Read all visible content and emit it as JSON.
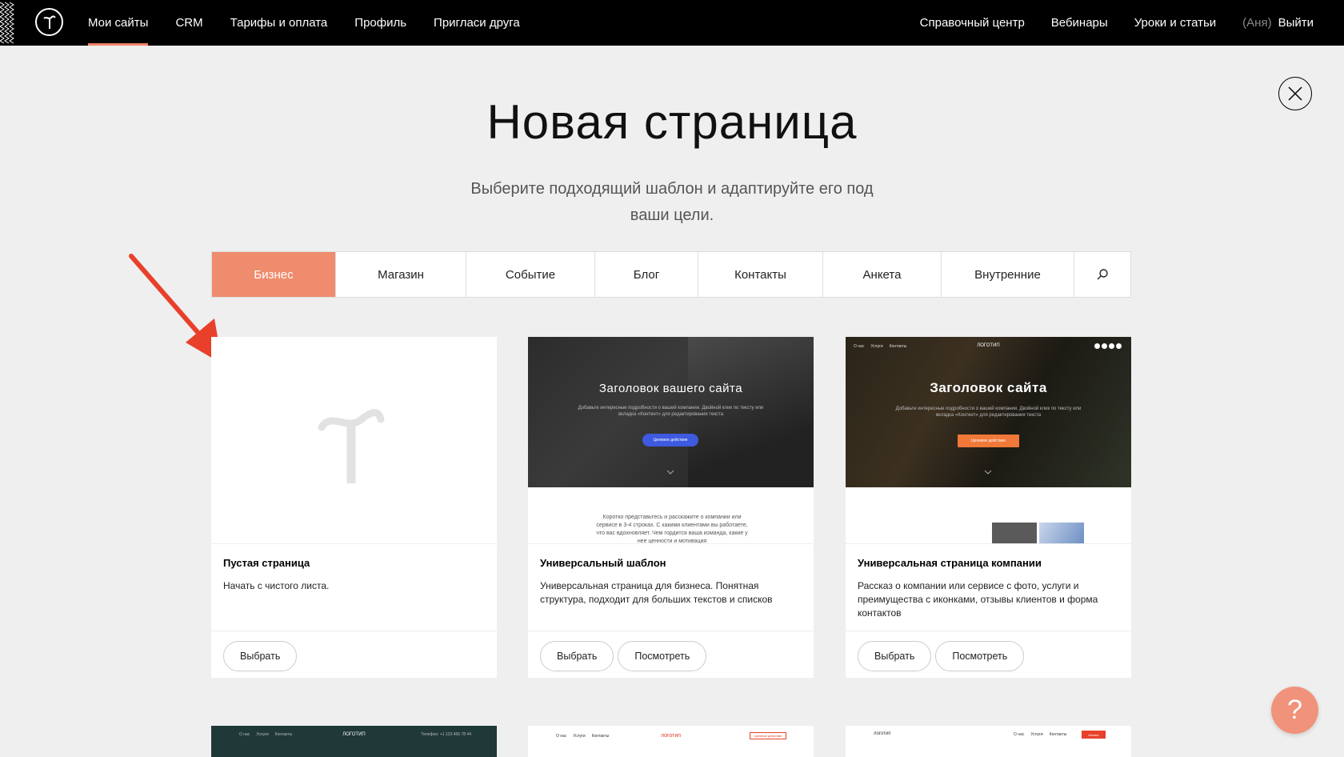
{
  "nav": {
    "left": [
      {
        "label": "Мои сайты",
        "active": true
      },
      {
        "label": "CRM"
      },
      {
        "label": "Тарифы и оплата"
      },
      {
        "label": "Профиль"
      },
      {
        "label": "Пригласи друга"
      }
    ],
    "right": [
      {
        "label": "Справочный центр"
      },
      {
        "label": "Вебинары"
      },
      {
        "label": "Уроки и статьи"
      }
    ],
    "user": "(Аня)",
    "logout": "Выйти"
  },
  "header": {
    "title": "Новая страница",
    "subtitle": "Выберите подходящий шаблон и адаптируйте его под ваши цели."
  },
  "tabs": [
    {
      "label": "Бизнес",
      "active": true
    },
    {
      "label": "Магазин"
    },
    {
      "label": "Событие"
    },
    {
      "label": "Блог"
    },
    {
      "label": "Контакты"
    },
    {
      "label": "Анкета"
    },
    {
      "label": "Внутренние"
    }
  ],
  "cards": [
    {
      "name": "Пустая страница",
      "desc": "Начать с чистого листа.",
      "select": "Выбрать"
    },
    {
      "name": "Универсальный шаблон",
      "desc": "Универсальная страница для бизнеса. Понятная структура, подходит для больших текстов и списков",
      "select": "Выбрать",
      "view": "Посмотреть",
      "thumb_title": "Заголовок вашего сайта",
      "thumb_sub": "Добавьте интересные подробности о вашей компании. Двойной клик по тексту или вкладка «Контент» для редактирования текста",
      "thumb_cta": "Целевое действие",
      "thumb_text": "Коротко представьтесь и расскажите о компании или сервисе в 3-4 строках. С какими клиентами вы работаете, что вас вдохновляет. Чем гордится ваша команда, какие у нее ценности и мотивация"
    },
    {
      "name": "Универсальная страница компании",
      "desc": "Рассказ о компании или сервисе с фото, услуги и преимущества с иконками, отзывы клиентов и форма контактов",
      "select": "Выбрать",
      "view": "Посмотреть",
      "thumb_title": "Заголовок сайта",
      "thumb_logo": "ЛОГОТИП",
      "thumb_menu": [
        "О нас",
        "Услуги",
        "Контакты"
      ],
      "thumb_sub": "Добавьте интересные подробности о вашей компании. Двойной клик по тексту или вкладка «Контент» для редактирования текста",
      "thumb_cta": "Целевое действие"
    }
  ],
  "partial_cards": [
    {
      "logo": "ЛОГОТИП",
      "menu": [
        "О нас",
        "Услуги",
        "Контакты"
      ],
      "phone": "Телефон: +1 123 456 78 44"
    },
    {
      "logo": "логотип",
      "menu": [
        "О нас",
        "Услуги",
        "Контакты"
      ],
      "cta": "Целевое действие"
    },
    {
      "logo": "логотип",
      "menu": [
        "О нас",
        "Услуги",
        "Контакты"
      ],
      "cta": "Кнопка"
    }
  ],
  "colors": {
    "accent": "#ef8c6d",
    "topbar": "#000000",
    "background": "#efefef",
    "arrow": "#e8402b"
  },
  "help_label": "?"
}
